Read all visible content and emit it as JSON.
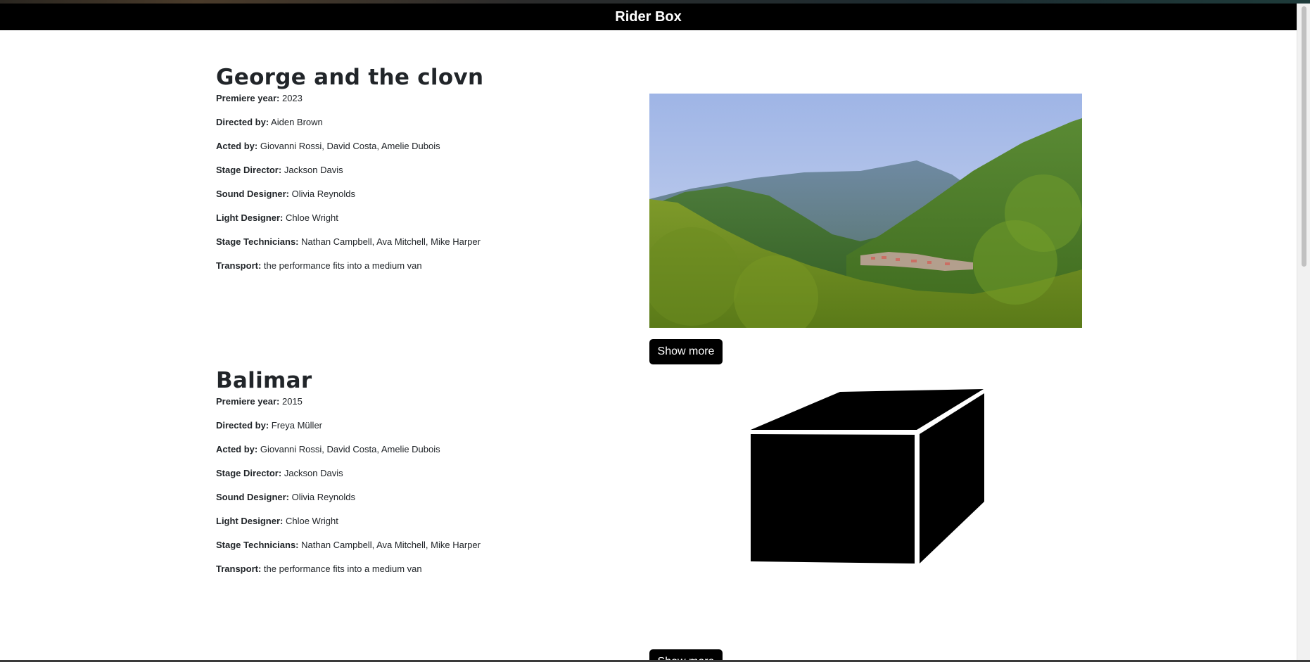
{
  "app": {
    "title": "Rider Box"
  },
  "colors": {
    "topbar": "#000000",
    "button": "#000000",
    "text": "#212529"
  },
  "shows": [
    {
      "title": "George and the clovn",
      "image": "landscape-mountains-town",
      "details": [
        {
          "label": "Premiere year:",
          "value": "2023"
        },
        {
          "label": "Directed by:",
          "value": "Aiden Brown"
        },
        {
          "label": "Acted by:",
          "value": "Giovanni Rossi, David Costa, Amelie Dubois"
        },
        {
          "label": "Stage Director:",
          "value": "Jackson Davis"
        },
        {
          "label": "Sound Designer:",
          "value": "Olivia Reynolds"
        },
        {
          "label": "Light Designer:",
          "value": "Chloe Wright"
        },
        {
          "label": "Stage Technicians:",
          "value": "Nathan Campbell, Ava Mitchell, Mike Harper"
        },
        {
          "label": "Transport:",
          "value": "the performance fits into a medium van"
        }
      ],
      "button": "Show more"
    },
    {
      "title": "Balimar",
      "image": "black-box",
      "details": [
        {
          "label": "Premiere year:",
          "value": "2015"
        },
        {
          "label": "Directed by:",
          "value": "Freya Müller"
        },
        {
          "label": "Acted by:",
          "value": "Giovanni Rossi, David Costa, Amelie Dubois"
        },
        {
          "label": "Stage Director:",
          "value": "Jackson Davis"
        },
        {
          "label": "Sound Designer:",
          "value": "Olivia Reynolds"
        },
        {
          "label": "Light Designer:",
          "value": "Chloe Wright"
        },
        {
          "label": "Stage Technicians:",
          "value": "Nathan Campbell, Ava Mitchell, Mike Harper"
        },
        {
          "label": "Transport:",
          "value": "the performance fits into a medium van"
        }
      ],
      "button": "Show more"
    }
  ]
}
